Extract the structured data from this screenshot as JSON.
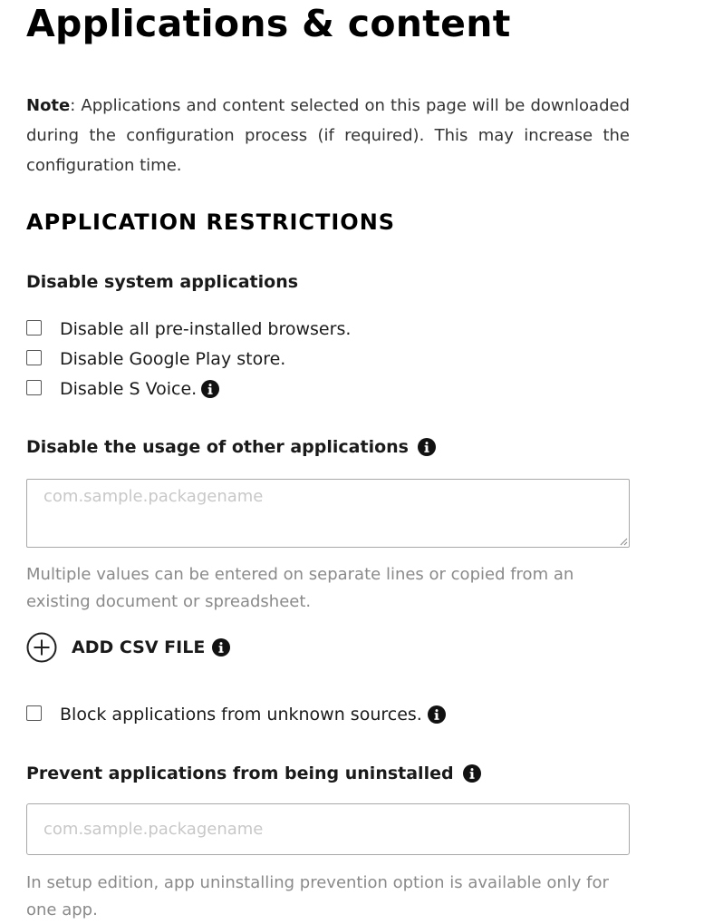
{
  "page": {
    "title": "Applications & content",
    "note_label": "Note",
    "note_text": ": Applications and content selected on this page will be downloaded during the configuration process (if required). This may increase the configuration time."
  },
  "restrictions": {
    "heading": "APPLICATION RESTRICTIONS",
    "system_apps": {
      "heading": "Disable system applications",
      "options": [
        {
          "label": "Disable all pre-installed browsers.",
          "checked": false
        },
        {
          "label": "Disable Google Play store.",
          "checked": false
        },
        {
          "label": "Disable S Voice.",
          "checked": false,
          "info_icon": "info-icon"
        }
      ]
    },
    "other_apps": {
      "heading": "Disable the usage of other applications",
      "info_icon": "info-icon",
      "placeholder": "com.sample.packagename",
      "value": "",
      "helper": "Multiple values can be entered on separate lines or copied from an existing document or spreadsheet.",
      "add_csv_label": "ADD CSV FILE",
      "add_csv_icon": "plus-circle-icon"
    },
    "unknown_sources": {
      "label": "Block applications from unknown sources.",
      "checked": false,
      "info_icon": "info-icon"
    },
    "prevent_uninstall": {
      "heading": "Prevent applications from being uninstalled",
      "info_icon": "info-icon",
      "placeholder": "com.sample.packagename",
      "value": "",
      "helper": "In setup edition, app uninstalling prevention option is available only for one app."
    }
  },
  "colors": {
    "text": "#1a1a1a",
    "muted": "#8a8a8a",
    "placeholder": "#c8c8c8",
    "border": "#a8a8a8"
  }
}
